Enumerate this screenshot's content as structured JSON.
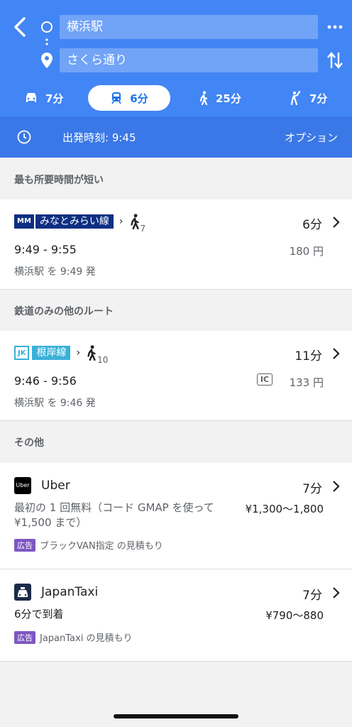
{
  "header": {
    "origin": "横浜駅",
    "destination": "さくら通り"
  },
  "modes": [
    {
      "label": "7分",
      "icon": "car-icon"
    },
    {
      "label": "6分",
      "icon": "transit-icon"
    },
    {
      "label": "25分",
      "icon": "walk-icon"
    },
    {
      "label": "7分",
      "icon": "ride-hail-icon"
    }
  ],
  "depart": {
    "label": "出発時刻: 9:45",
    "options": "オプション"
  },
  "sections": {
    "fastest": "最も所要時間が短い",
    "rail_only": "鉄道のみの他のルート",
    "other": "その他"
  },
  "routes": [
    {
      "line_code": "MM",
      "line_name": "みなとみらい線",
      "walk_min": "7",
      "duration": "6分",
      "times": "9:49 - 9:55",
      "fare": "180 円",
      "depart_from": "横浜駅 を 9:49 発",
      "badge_color": "#0d2f83"
    },
    {
      "line_code": "JK",
      "line_name": "根岸線",
      "walk_min": "10",
      "duration": "11分",
      "times": "9:46 - 9:56",
      "fare_ic": "IC",
      "fare": "133 円",
      "depart_from": "横浜駅 を 9:46 発",
      "badge_color": "#3bb1d9"
    }
  ],
  "services": [
    {
      "name": "Uber",
      "logo": "Uber",
      "duration": "7分",
      "desc_line1": "最初の 1 回無料（コード GMAP を使って",
      "desc_line2": "¥1,500 まで）",
      "price": "¥1,300〜1,800",
      "ad": "広告",
      "ad_text": "ブラックVAN指定 の見積もり"
    },
    {
      "name": "JapanTaxi",
      "duration": "7分",
      "desc_line1": "6分で到着",
      "price": "¥790〜880",
      "ad": "広告",
      "ad_text": "JapanTaxi の見積もり"
    }
  ]
}
